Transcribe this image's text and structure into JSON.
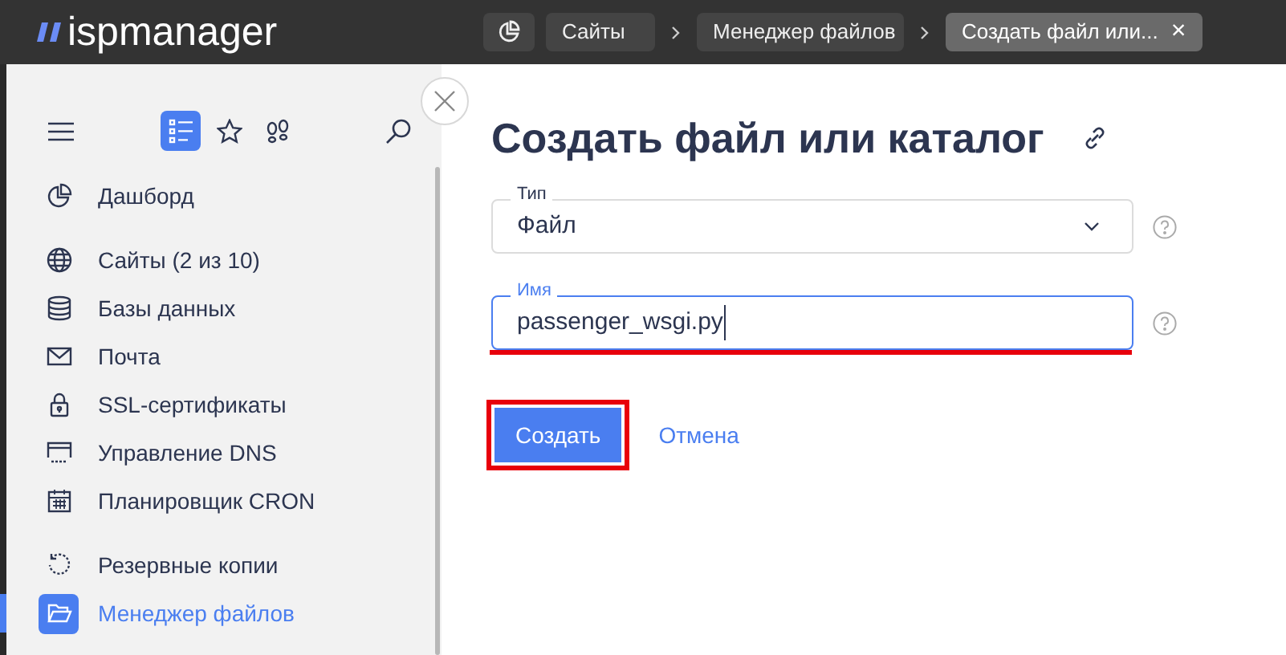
{
  "header": {
    "logo": "ispmanager",
    "breadcrumbs": [
      {
        "label": "Сайты",
        "current": false
      },
      {
        "label": "Менеджер файлов",
        "current": false
      },
      {
        "label": "Создать файл или...",
        "current": true,
        "close": "×"
      }
    ]
  },
  "sidebar": {
    "tabs": [
      {
        "kind": "list",
        "selected": true
      },
      {
        "kind": "star",
        "selected": false
      },
      {
        "kind": "steps",
        "selected": false
      }
    ],
    "groups": [
      [
        {
          "label": "Дашборд",
          "kind": "dashboard",
          "selected": false
        }
      ],
      [
        {
          "label": "Сайты (2 из 10)",
          "kind": "globe",
          "selected": false
        },
        {
          "label": "Базы данных",
          "kind": "db",
          "selected": false
        },
        {
          "label": "Почта",
          "kind": "mail",
          "selected": false
        },
        {
          "label": "SSL-сертификаты",
          "kind": "lock",
          "selected": false
        },
        {
          "label": "Управление DNS",
          "kind": "dns",
          "selected": false
        },
        {
          "label": "Планировщик CRON",
          "kind": "calendar",
          "selected": false
        }
      ],
      [
        {
          "label": "Резервные копии",
          "kind": "backup",
          "selected": false
        },
        {
          "label": "Менеджер файлов",
          "kind": "folder",
          "selected": true
        }
      ]
    ]
  },
  "form": {
    "title": "Создать файл или каталог",
    "fields": [
      {
        "kind": "select",
        "label": "Тип",
        "value": "Файл",
        "focused": false
      },
      {
        "kind": "text",
        "label": "Имя",
        "value": "passenger_wsgi.py",
        "focused": true
      }
    ],
    "buttons": [
      {
        "label": "Создать",
        "kind": "primary"
      },
      {
        "label": "Отмена",
        "kind": "link"
      }
    ]
  }
}
